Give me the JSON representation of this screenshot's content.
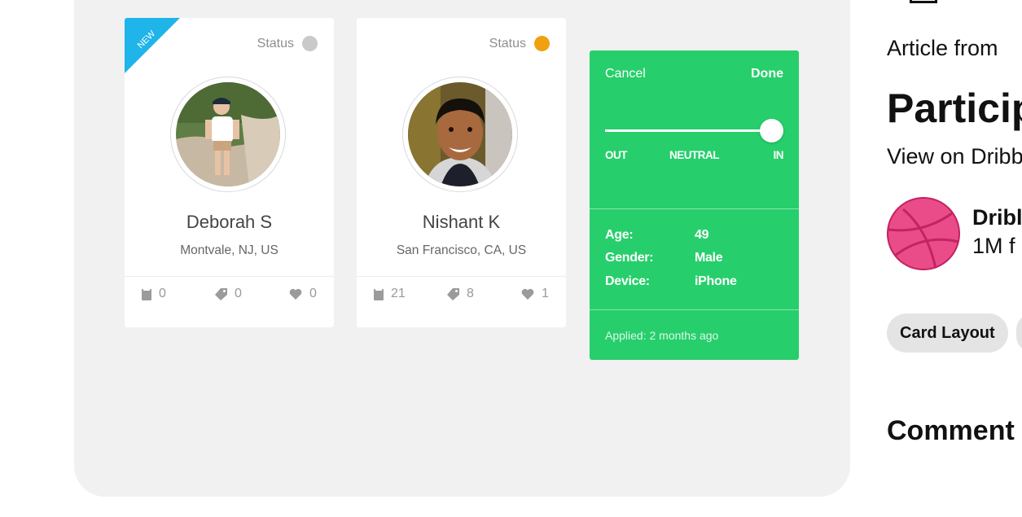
{
  "cards": [
    {
      "badge": "NEW",
      "status_label": "Status",
      "status_color": "#c9c9c9",
      "name": "Deborah S",
      "location": "Montvale, NJ, US",
      "stats": {
        "notes": "0",
        "tags": "0",
        "likes": "0"
      }
    },
    {
      "status_label": "Status",
      "status_color": "#f0a10f",
      "name": "Nishant K",
      "location": "San Francisco, CA, US",
      "stats": {
        "notes": "21",
        "tags": "8",
        "likes": "1"
      }
    }
  ],
  "edit_card": {
    "cancel_label": "Cancel",
    "done_label": "Done",
    "slider": {
      "labels": [
        "OUT",
        "NEUTRAL",
        "IN"
      ],
      "value": "IN"
    },
    "details": [
      {
        "label": "Age:",
        "value": "49"
      },
      {
        "label": "Gender:",
        "value": "Male"
      },
      {
        "label": "Device:",
        "value": "iPhone"
      }
    ],
    "applied": "Applied: 2 months ago",
    "color": "#26cf6b"
  },
  "sidebar": {
    "article_from": "Article from",
    "title": "Particip",
    "view_on": "View on Dribb",
    "source_name": "Dribl",
    "source_followers": "1M f",
    "tags": [
      "Card Layout"
    ],
    "comments_heading": "Comment",
    "accent": "#ea4c89"
  }
}
